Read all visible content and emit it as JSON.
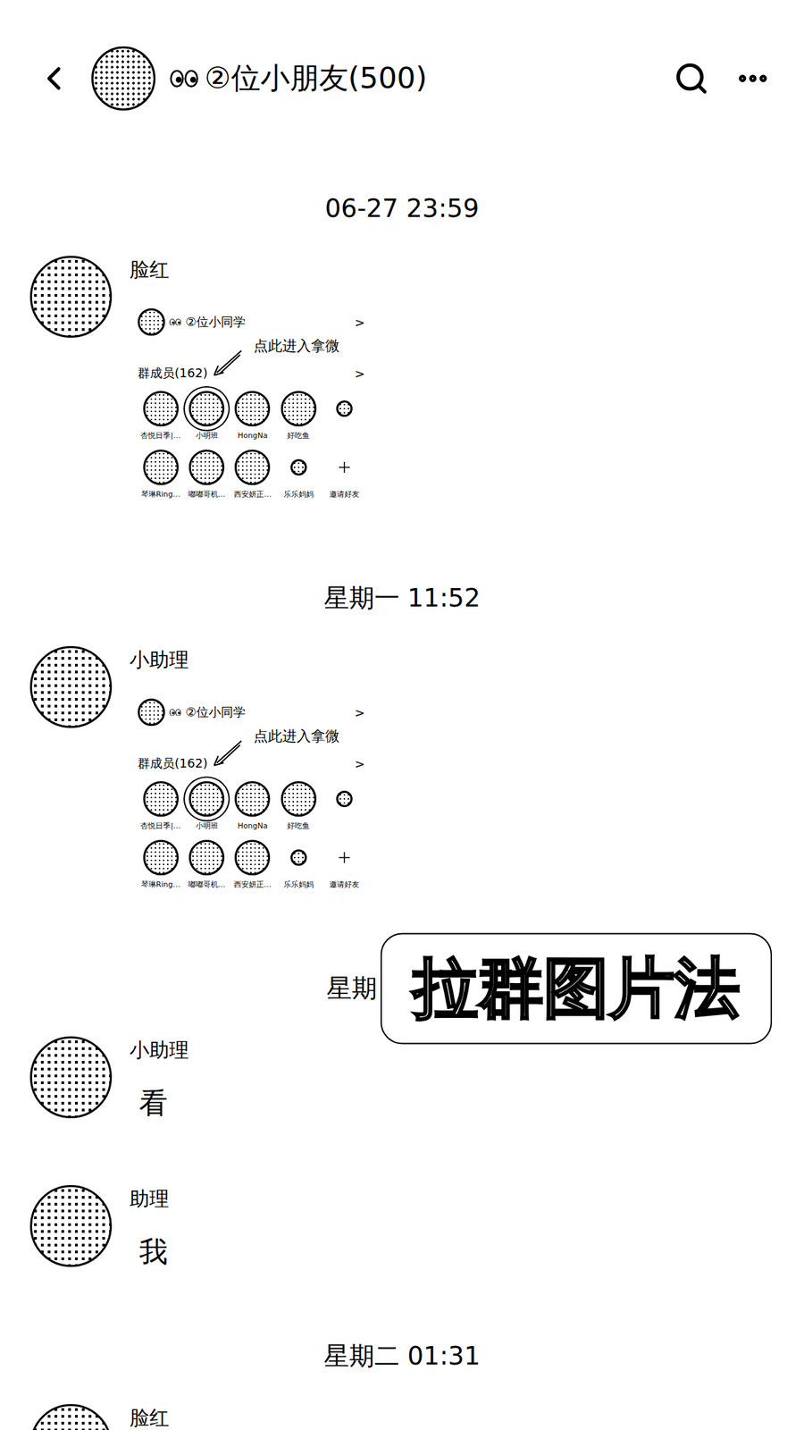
{
  "header": {
    "title": "②位小朋友(500)"
  },
  "chat": [
    {
      "kind": "time",
      "text": "06-27 23:59"
    },
    {
      "kind": "image",
      "sender": "脸红",
      "card": {
        "group": "②位小同学",
        "chevron": ">",
        "annotation": "点此进入拿微",
        "members_label": "群成员(162)",
        "members_chevron": ">",
        "members": [
          {
            "name": "杏悦日季|…",
            "kind": "avatar",
            "highlighted": false
          },
          {
            "name": "小明班",
            "kind": "avatar",
            "highlighted": true
          },
          {
            "name": "HongNa",
            "kind": "avatar",
            "highlighted": false
          },
          {
            "name": "好吃鱼",
            "kind": "avatar",
            "highlighted": false
          },
          {
            "name": "",
            "kind": "small",
            "highlighted": false
          },
          {
            "name": "琴琳Ring…",
            "kind": "avatar",
            "highlighted": false
          },
          {
            "name": "嘟嘟哥机…",
            "kind": "avatar",
            "highlighted": false
          },
          {
            "name": "西安妍正…",
            "kind": "avatar",
            "highlighted": false
          },
          {
            "name": "乐乐妈妈",
            "kind": "small",
            "highlighted": false
          },
          {
            "name": "邀请好友",
            "kind": "invite",
            "highlighted": false
          }
        ]
      }
    },
    {
      "kind": "time",
      "text": "星期一 11:52"
    },
    {
      "kind": "image",
      "sender": "小助理",
      "card": {
        "group": "②位小同学",
        "chevron": ">",
        "annotation": "点此进入拿微",
        "members_label": "群成员(162)",
        "members_chevron": ">",
        "members": [
          {
            "name": "杏悦日季|…",
            "kind": "avatar",
            "highlighted": false
          },
          {
            "name": "小明班",
            "kind": "avatar",
            "highlighted": true
          },
          {
            "name": "HongNa",
            "kind": "avatar",
            "highlighted": false
          },
          {
            "name": "好吃鱼",
            "kind": "avatar",
            "highlighted": false
          },
          {
            "name": "",
            "kind": "small",
            "highlighted": false
          },
          {
            "name": "琴琳Ring…",
            "kind": "avatar",
            "highlighted": false
          },
          {
            "name": "嘟嘟哥机…",
            "kind": "avatar",
            "highlighted": false
          },
          {
            "name": "西安妍正…",
            "kind": "avatar",
            "highlighted": false
          },
          {
            "name": "乐乐妈妈",
            "kind": "small",
            "highlighted": false
          },
          {
            "name": "邀请好友",
            "kind": "invite",
            "highlighted": false
          }
        ]
      }
    },
    {
      "kind": "time",
      "text": "星期",
      "overlay": "拉群图片法"
    },
    {
      "kind": "text",
      "sender": "小助理",
      "text": "看"
    },
    {
      "kind": "text",
      "sender": "助理",
      "text": "我"
    },
    {
      "kind": "time",
      "text": "星期二 01:31"
    },
    {
      "kind": "text",
      "sender": "脸红",
      "text": ""
    }
  ]
}
